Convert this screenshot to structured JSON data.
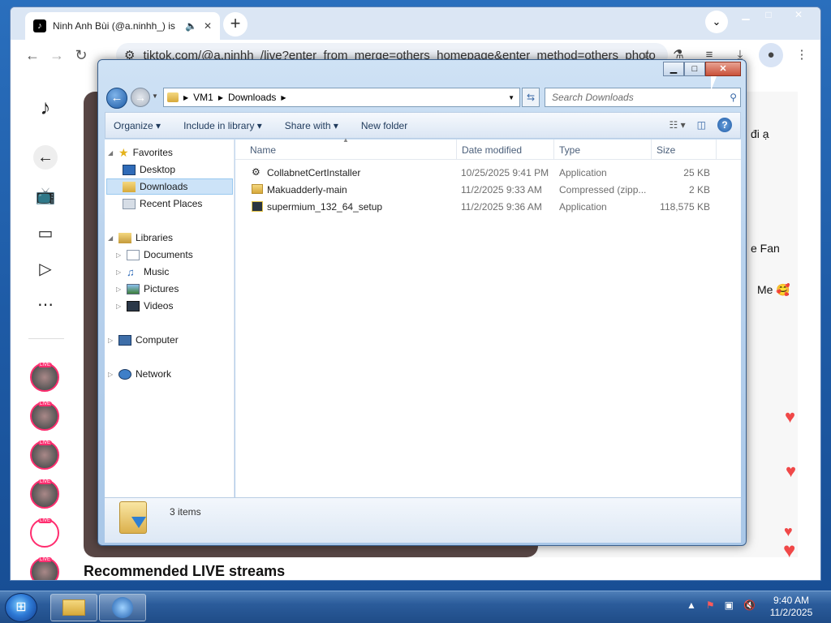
{
  "browser": {
    "tab_title": "Ninh Anh Bùi (@a.ninhh_) is",
    "tab_favicon": "tiktok-icon",
    "url": "tiktok.com/@a.ninhh_/live?enter_from_merge=others_homepage&enter_method=others_photo"
  },
  "page": {
    "right_texts": [
      "đi ạ",
      "e Fan",
      "Me 🥰"
    ],
    "recommended": "Recommended LIVE streams"
  },
  "explorer": {
    "breadcrumb": [
      "VM1",
      "Downloads"
    ],
    "search_placeholder": "Search Downloads",
    "commands": [
      "Organize",
      "Include in library",
      "Share with",
      "New folder"
    ],
    "nav": {
      "favorites": "Favorites",
      "favorites_items": [
        "Desktop",
        "Downloads",
        "Recent Places"
      ],
      "libraries": "Libraries",
      "libraries_items": [
        "Documents",
        "Music",
        "Pictures",
        "Videos"
      ],
      "computer": "Computer",
      "network": "Network"
    },
    "columns": [
      "Name",
      "Date modified",
      "Type",
      "Size"
    ],
    "files": [
      {
        "name": "CollabnetCertInstaller",
        "date": "10/25/2025 9:41 PM",
        "type": "Application",
        "size": "25 KB"
      },
      {
        "name": "Makuadderly-main",
        "date": "11/2/2025 9:33 AM",
        "type": "Compressed (zipp...",
        "size": "2 KB"
      },
      {
        "name": "supermium_132_64_setup",
        "date": "11/2/2025 9:36 AM",
        "type": "Application",
        "size": "118,575 KB"
      }
    ],
    "item_count": "3 items"
  },
  "taskbar": {
    "time": "9:40 AM",
    "date": "11/2/2025"
  }
}
